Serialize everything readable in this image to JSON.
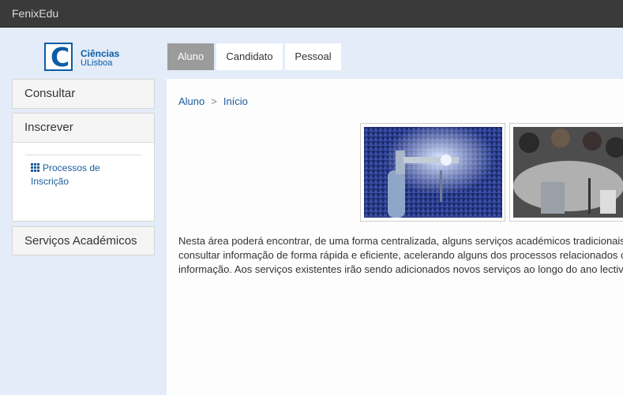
{
  "app": {
    "brand": "FenixEdu"
  },
  "logo": {
    "line1": "Ciências",
    "line2": "ULisboa",
    "letter": "C"
  },
  "sidebar": {
    "consultar": "Consultar",
    "inscrever": "Inscrever",
    "processos_line1": "Processos de",
    "processos_line2": "Inscrição",
    "servicos": "Serviços Académicos"
  },
  "tabs": [
    {
      "label": "Aluno",
      "active": true
    },
    {
      "label": "Candidato",
      "active": false
    },
    {
      "label": "Pessoal",
      "active": false
    }
  ],
  "breadcrumb": {
    "first": "Aluno",
    "separator": ">",
    "second": "Início"
  },
  "content": {
    "line1": "Nesta área poderá encontrar, de uma forma centralizada, alguns serviços académicos tradicionais",
    "line2": "consultar informação de forma rápida e eficiente, acelerando alguns dos processos relacionados c",
    "line3": "informação. Aos serviços existentes irão sendo adicionados novos serviços ao longo do ano lectiv"
  },
  "colors": {
    "accent": "#1b5c9e",
    "topbar": "#3a3a3a",
    "page_bg": "#e3ecf8"
  }
}
